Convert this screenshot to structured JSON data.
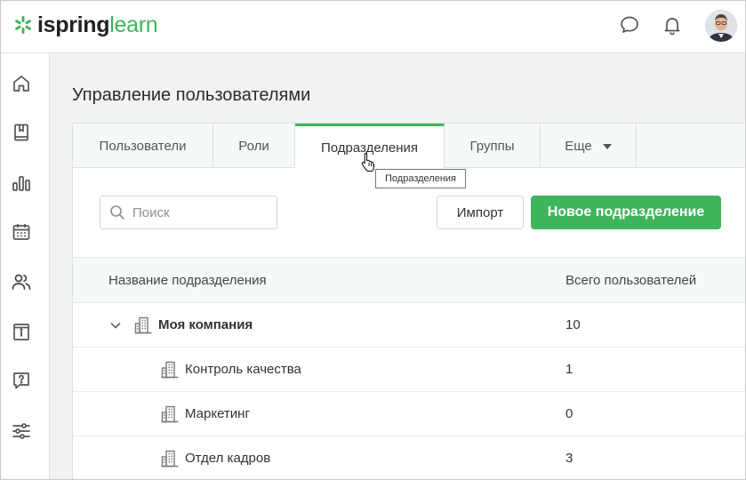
{
  "brand": {
    "name_part1": "ispring",
    "name_part2": "learn",
    "accent": "#3fb55b"
  },
  "header": {
    "icons": [
      "chat-bubble-icon",
      "bell-icon"
    ],
    "avatar": "user-avatar"
  },
  "sidebar": {
    "items": [
      {
        "icon": "home-icon"
      },
      {
        "icon": "book-icon"
      },
      {
        "icon": "bar-chart-icon"
      },
      {
        "icon": "calendar-icon"
      },
      {
        "icon": "users-icon",
        "active": true
      },
      {
        "icon": "info-card-icon"
      },
      {
        "icon": "question-icon"
      },
      {
        "icon": "sliders-icon"
      }
    ]
  },
  "page": {
    "title": "Управление пользователями"
  },
  "tabs": [
    {
      "label": "Пользователи"
    },
    {
      "label": "Роли"
    },
    {
      "label": "Подразделения",
      "active": true
    },
    {
      "label": "Группы"
    },
    {
      "label": "Еще"
    }
  ],
  "tooltip": "Подразделения",
  "toolbar": {
    "search_placeholder": "Поиск",
    "import_label": "Импорт",
    "new_label": "Новое подразделение"
  },
  "table": {
    "columns": [
      "Название подразделения",
      "Всего пользователей"
    ],
    "rows": [
      {
        "name": "Моя компания",
        "count": "10",
        "level": 0,
        "expanded": true
      },
      {
        "name": "Контроль качества",
        "count": "1",
        "level": 1
      },
      {
        "name": "Маркетинг",
        "count": "0",
        "level": 1
      },
      {
        "name": "Отдел кадров",
        "count": "3",
        "level": 1
      }
    ]
  }
}
